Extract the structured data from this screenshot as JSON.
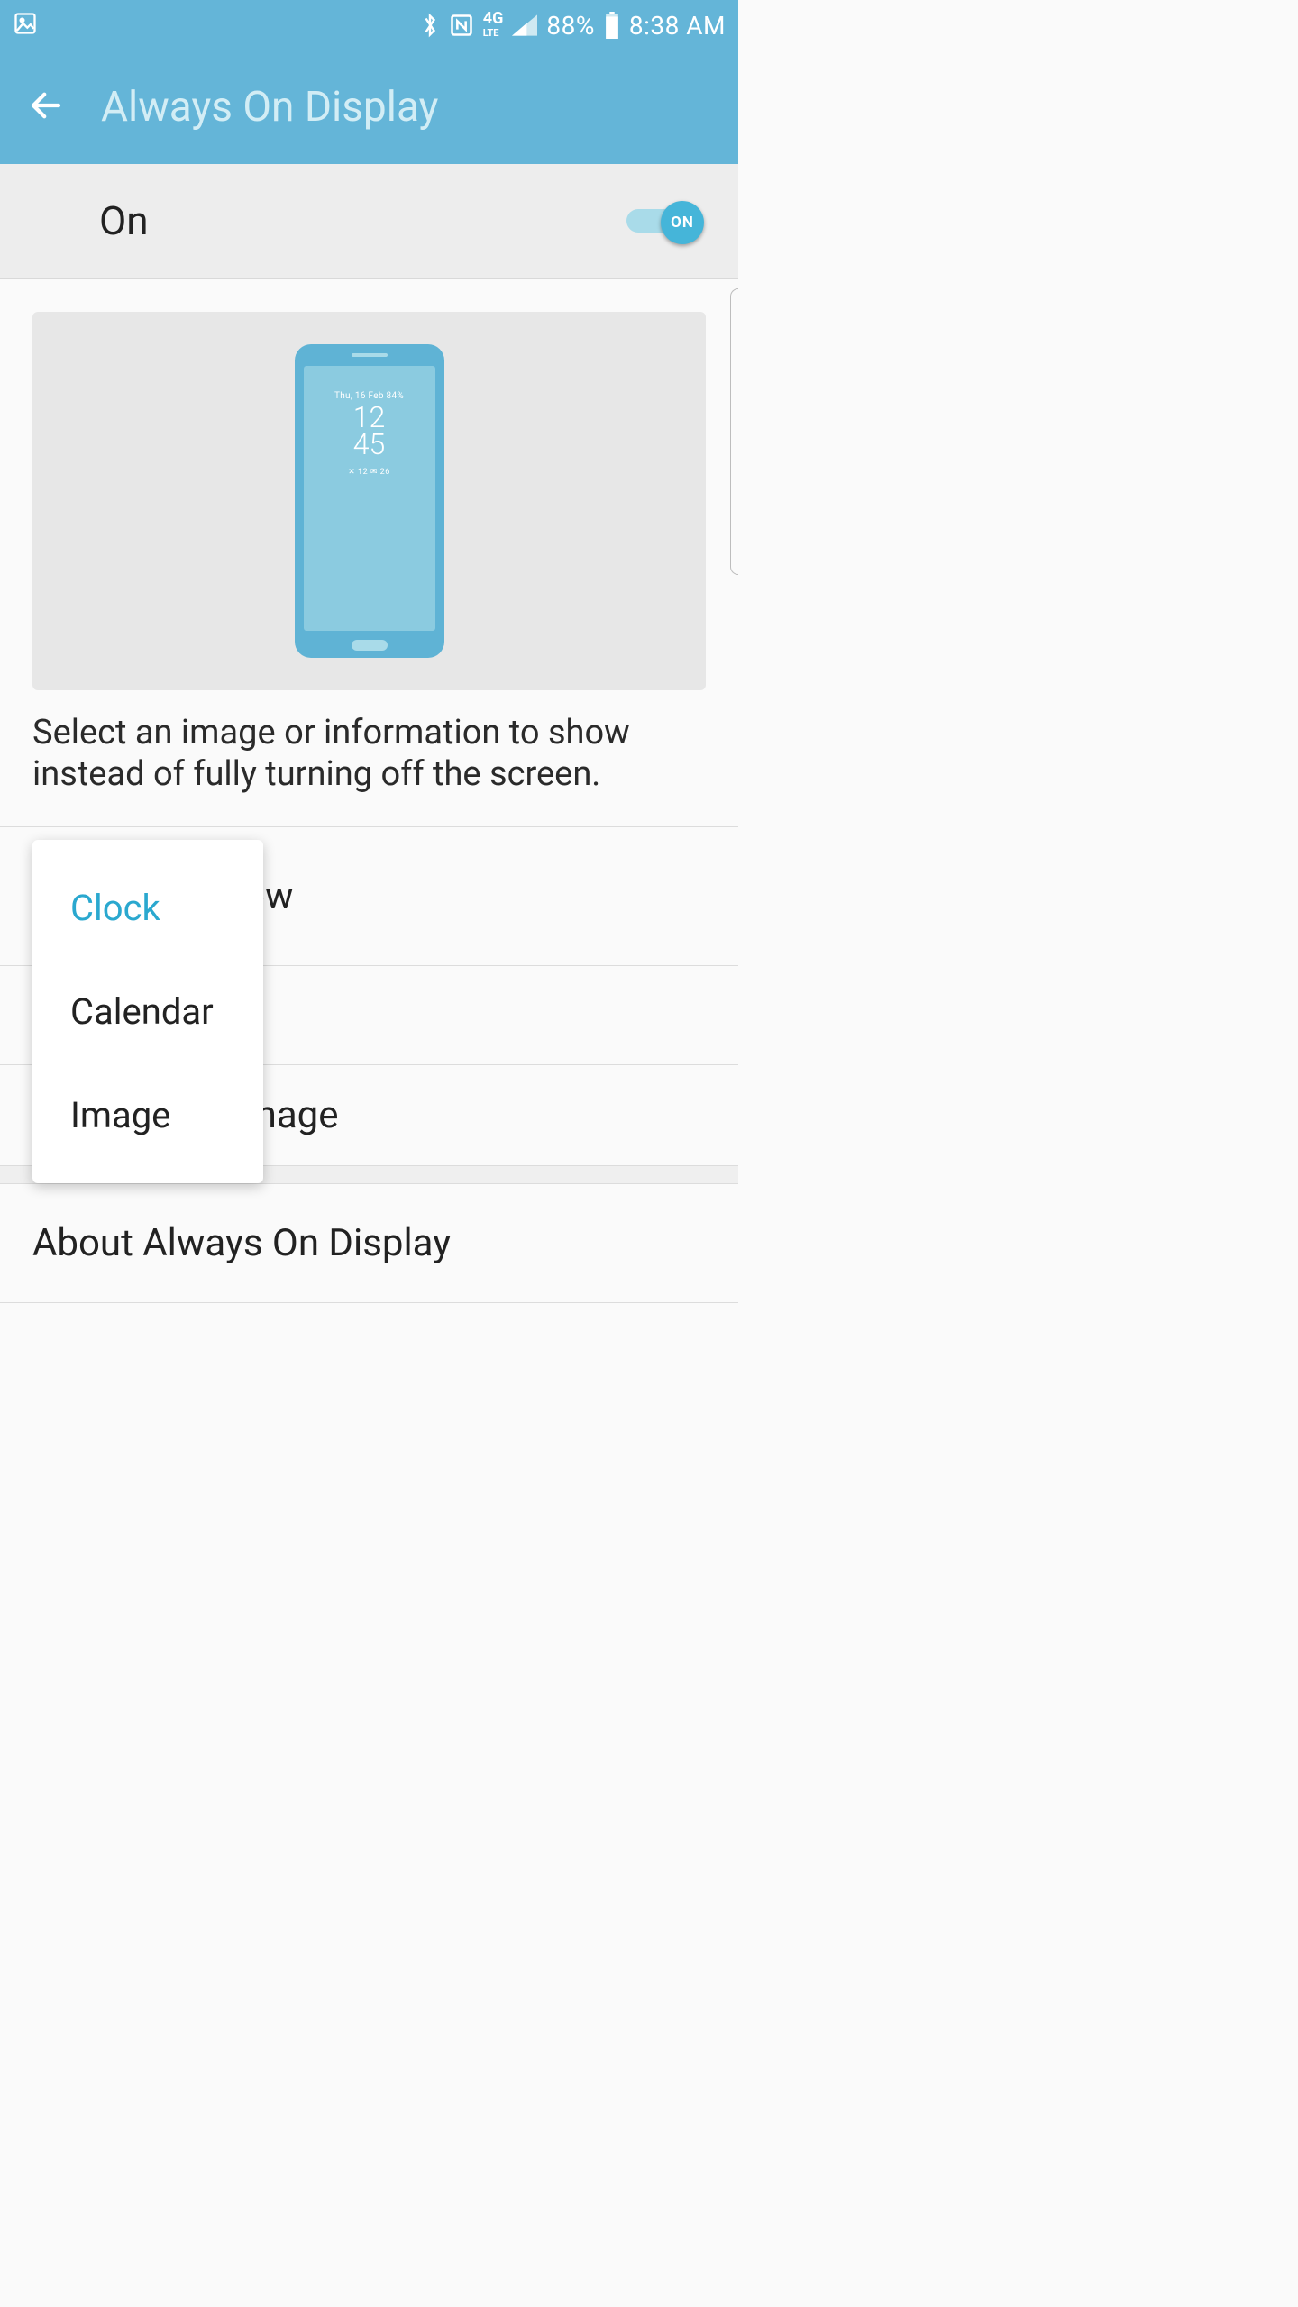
{
  "status": {
    "battery_pct": "88%",
    "time": "8:38 AM",
    "network_label": "4G LTE"
  },
  "appbar": {
    "title": "Always On Display"
  },
  "toggle": {
    "label": "On",
    "knob": "ON"
  },
  "preview": {
    "date_line": "Thu, 16 Feb  84%",
    "hh": "12",
    "mm": "45",
    "subline": "✕ 12    ✉ 26"
  },
  "description": "Select an image or information to show instead of fully turning off the screen.",
  "items": {
    "content_to_show": {
      "title_partial_visible": "ow"
    },
    "background_image": {
      "title_partial_visible": "mage"
    },
    "about": {
      "title": "About Always On Display"
    }
  },
  "popup": {
    "options": [
      {
        "label": "Clock",
        "selected": true
      },
      {
        "label": "Calendar",
        "selected": false
      },
      {
        "label": "Image",
        "selected": false
      }
    ]
  },
  "colors": {
    "accent": "#64b5d8",
    "accent_dark": "#45b5d9",
    "text": "#222222",
    "subtitle": "#6aa7bc"
  }
}
